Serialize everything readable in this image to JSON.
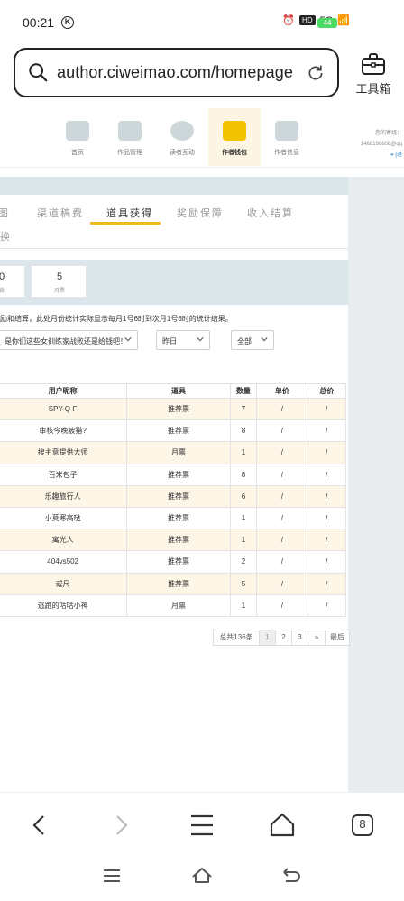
{
  "status": {
    "time": "00:21",
    "k_badge": "K",
    "hd": "HD",
    "signal": "5G",
    "battery": "44"
  },
  "browser": {
    "url": "author.ciweimao.com/homepage",
    "toolbox_label": "工具箱",
    "tab_count": "8"
  },
  "site_nav": {
    "items": [
      {
        "label": "首页"
      },
      {
        "label": "作品管理"
      },
      {
        "label": "读者互动"
      },
      {
        "label": "作者钱包"
      },
      {
        "label": "作者信息"
      }
    ],
    "user_line1": "您的寄组：",
    "user_line2": "1468198608@qq",
    "user_line3": "[退"
  },
  "tabs": {
    "t0": "图",
    "t1": "渠道稿费",
    "t2": "道具获得",
    "t3": "奖励保障",
    "t4": "收入结算",
    "row2": "换"
  },
  "stats": {
    "s0_num": "0",
    "s0_label": "背",
    "s1_num": "5",
    "s1_label": "月票"
  },
  "note": "励和结算，此处月份统计实际显示每月1号6时到次月1号6时的统计结果。",
  "filters": {
    "f0": "是你们这些女训练家战败还是给钱吧！",
    "f1": "昨日",
    "f2": "全部"
  },
  "table": {
    "headers": [
      "用户昵称",
      "道具",
      "数量",
      "单价",
      "总价"
    ],
    "rows": [
      [
        "SPY-Q-F",
        "推荐票",
        "7",
        "/",
        "/"
      ],
      [
        "审核今晚被猎?",
        "推荐票",
        "8",
        "/",
        "/"
      ],
      [
        "搜主意提供大师",
        "月票",
        "1",
        "/",
        "/"
      ],
      [
        "百米包子",
        "推荐票",
        "8",
        "/",
        "/"
      ],
      [
        "乐趣旅行人",
        "推荐票",
        "6",
        "/",
        "/"
      ],
      [
        "小莫寒高哒",
        "推荐票",
        "1",
        "/",
        "/"
      ],
      [
        "寓光人",
        "推荐票",
        "1",
        "/",
        "/"
      ],
      [
        "404vs502",
        "推荐票",
        "2",
        "/",
        "/"
      ],
      [
        "或尺",
        "推荐票",
        "5",
        "/",
        "/"
      ],
      [
        "逃跑的咕咕小神",
        "月票",
        "1",
        "/",
        "/"
      ]
    ]
  },
  "pager": {
    "total": "总共136条",
    "p1": "1",
    "p2": "2",
    "p3": "3",
    "next": "»",
    "last": "最后"
  }
}
